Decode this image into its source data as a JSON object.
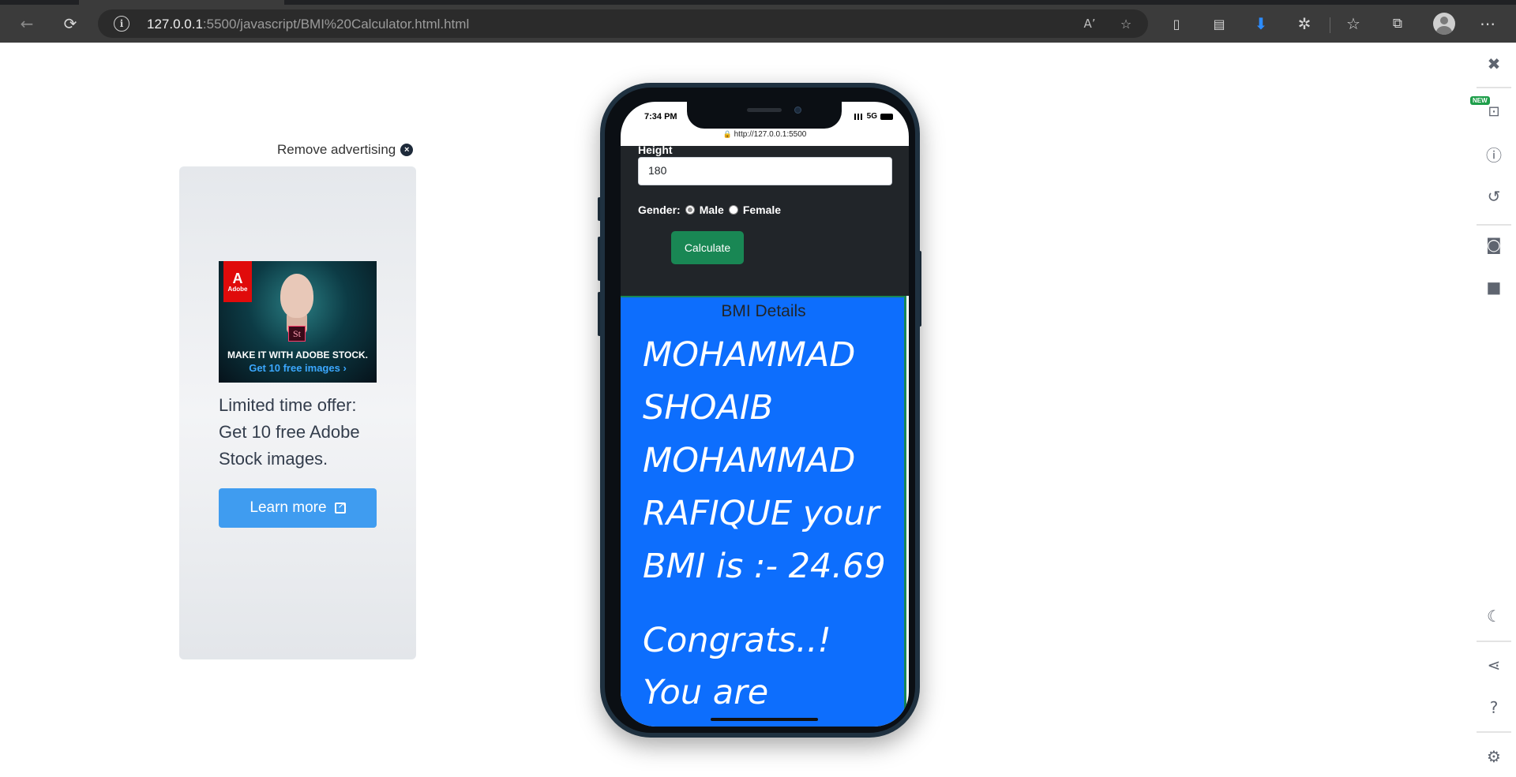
{
  "browser": {
    "url_host": "127.0.0.1",
    "url_rest": ":5500/javascript/BMI%20Calculator.html.html",
    "icons": {
      "back": "back-arrow-icon",
      "reload": "reload-icon",
      "info": "info-icon",
      "read_aloud": "read-aloud-icon",
      "favorite": "add-favorite-icon",
      "extensions": "extensions-icon",
      "downloads": "download-icon",
      "favorites": "favorites-icon",
      "collections": "collections-icon",
      "menu": "more-menu-icon"
    },
    "read_aloud_text": "Aʼ",
    "info_glyph": "i",
    "menu_glyph": "⋯"
  },
  "sidepanel": {
    "new_badge": "NEW",
    "icons": [
      "close-icon",
      "responsive-device-icon",
      "info-icon",
      "rotate-icon",
      "camera-icon",
      "video-icon",
      "dark-mode-icon",
      "share-icon",
      "help-icon",
      "settings-icon"
    ]
  },
  "ad": {
    "remove_label": "Remove advertising",
    "remove_glyph": "×",
    "adobe_a": "A",
    "adobe_label": "Adobe",
    "st_label": "St",
    "caption_main": "MAKE IT WITH ADOBE STOCK.",
    "caption_sub": "Get 10 free images ›",
    "offer_text": "Limited time offer: Get 10 free Adobe Stock images.",
    "cta_label": "Learn more"
  },
  "phone": {
    "status_time": "7:34 PM",
    "network": "5G",
    "address": "http://127.0.0.1:5500",
    "lock_glyph": "🔒"
  },
  "form": {
    "height_label": "Height",
    "height_value": "180",
    "gender_label": "Gender:",
    "gender_options": [
      "Male",
      "Female"
    ],
    "gender_selected": "Male",
    "calculate_label": "Calculate"
  },
  "result": {
    "title": "BMI Details",
    "bmi_message": "MOHAMMAD SHOAIB MOHAMMAD RAFIQUE your BMI is :- 24.69",
    "bmi_value": 24.69,
    "status_message": "Congrats..! You are Healthy."
  },
  "colors": {
    "result_bg": "#0d6efd",
    "form_bg": "#212529",
    "button_green": "#198754",
    "ad_button": "#3f9cf0"
  }
}
